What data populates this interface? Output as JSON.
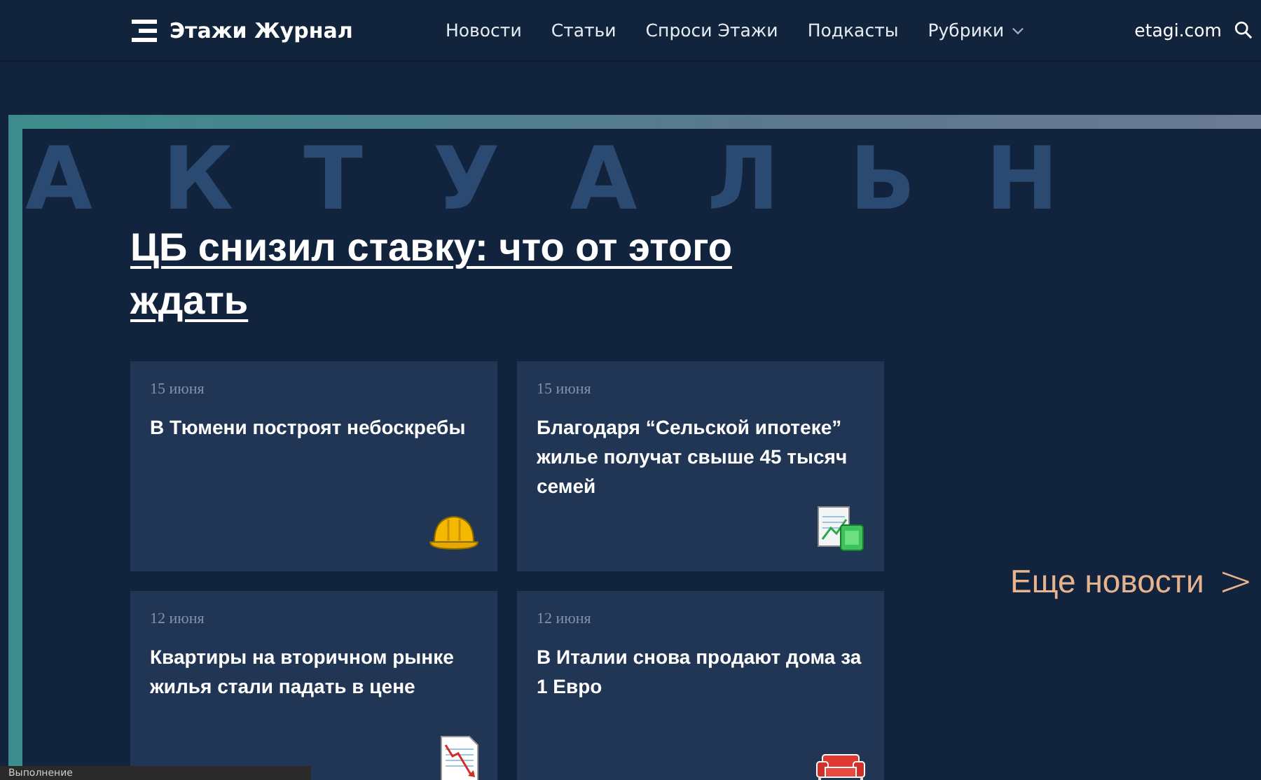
{
  "header": {
    "logo": "Этажи Журнал",
    "nav": [
      {
        "label": "Новости",
        "dropdown": false
      },
      {
        "label": "Статьи",
        "dropdown": false
      },
      {
        "label": "Спроси Этажи",
        "dropdown": false
      },
      {
        "label": "Подкасты",
        "dropdown": false
      },
      {
        "label": "Рубрики",
        "dropdown": true
      }
    ],
    "site_link": "etagi.com"
  },
  "hero": {
    "background_word": "АКТУАЛЬН",
    "headline": "ЦБ снизил ставку: что от этого ждать"
  },
  "cards": [
    {
      "date": "15 июня",
      "title": "В Тюмени построят небоскребы",
      "kind": "helmet"
    },
    {
      "date": "15 июня",
      "title": "Благодаря “Сельской ипотеке” жилье получат свыше 45 тысяч семей",
      "kind": "money"
    },
    {
      "date": "12 июня",
      "title": "Квартиры на вторичном рынке жилья стали падать в цене",
      "kind": "decline"
    },
    {
      "date": "12 июня",
      "title": "В Италии снова продают дома за 1 Евро",
      "kind": "sofa"
    }
  ],
  "more_link": {
    "label": "Еще новости",
    "arrow": ">"
  },
  "status_bar": "Выполнение"
}
